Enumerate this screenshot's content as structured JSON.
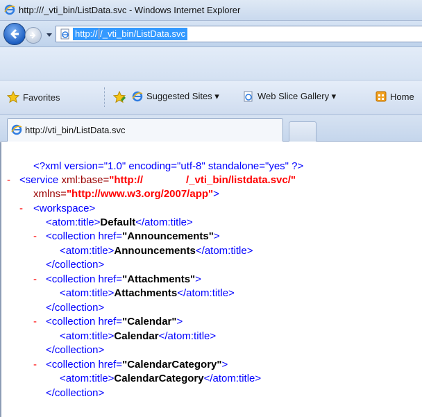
{
  "window": {
    "title_prefix": "http://",
    "title_redacted": "     ",
    "title_suffix": "/_vti_bin/ListData.svc - Windows Internet Explorer"
  },
  "address_bar": {
    "prefix": "http://",
    "redacted": "        ",
    "suffix": "/_vti_bin/ListData.svc"
  },
  "favorites_bar": {
    "favorites_label": "Favorites",
    "suggested_sites_label": "Suggested Sites ▾",
    "web_slice_label": "Web Slice Gallery ▾",
    "home_label": "Home"
  },
  "tab": {
    "prefix": "http://",
    "redacted": "      ",
    "suffix": "vti_bin/ListData.svc"
  },
  "xml": {
    "declaration": "<?xml version=\"1.0\" encoding=\"utf-8\" standalone=\"yes\" ?>",
    "service_open": "<service",
    "xml_base_attr": " xml:base=",
    "xml_base_prefix": "\"http://",
    "xml_base_suffix": "/_vti_bin/listdata.svc/\"",
    "xmlns_attr": "xmlns=",
    "xmlns_value": "\"http://www.w3.org/2007/app\"",
    "close_bracket": ">",
    "workspace_open": "<workspace>",
    "atom_title_open": "<atom:title>",
    "atom_title_close": "</atom:title>",
    "workspace_title": "Default",
    "collection_open": "<collection href=",
    "collection_close": "</collection>",
    "collections": [
      {
        "href": "\"Announcements\"",
        "title": "Announcements"
      },
      {
        "href": "\"Attachments\"",
        "title": "Attachments"
      },
      {
        "href": "\"Calendar\"",
        "title": "Calendar"
      },
      {
        "href": "\"CalendarCategory\"",
        "title": "CalendarCategory"
      }
    ],
    "minus": "-"
  }
}
